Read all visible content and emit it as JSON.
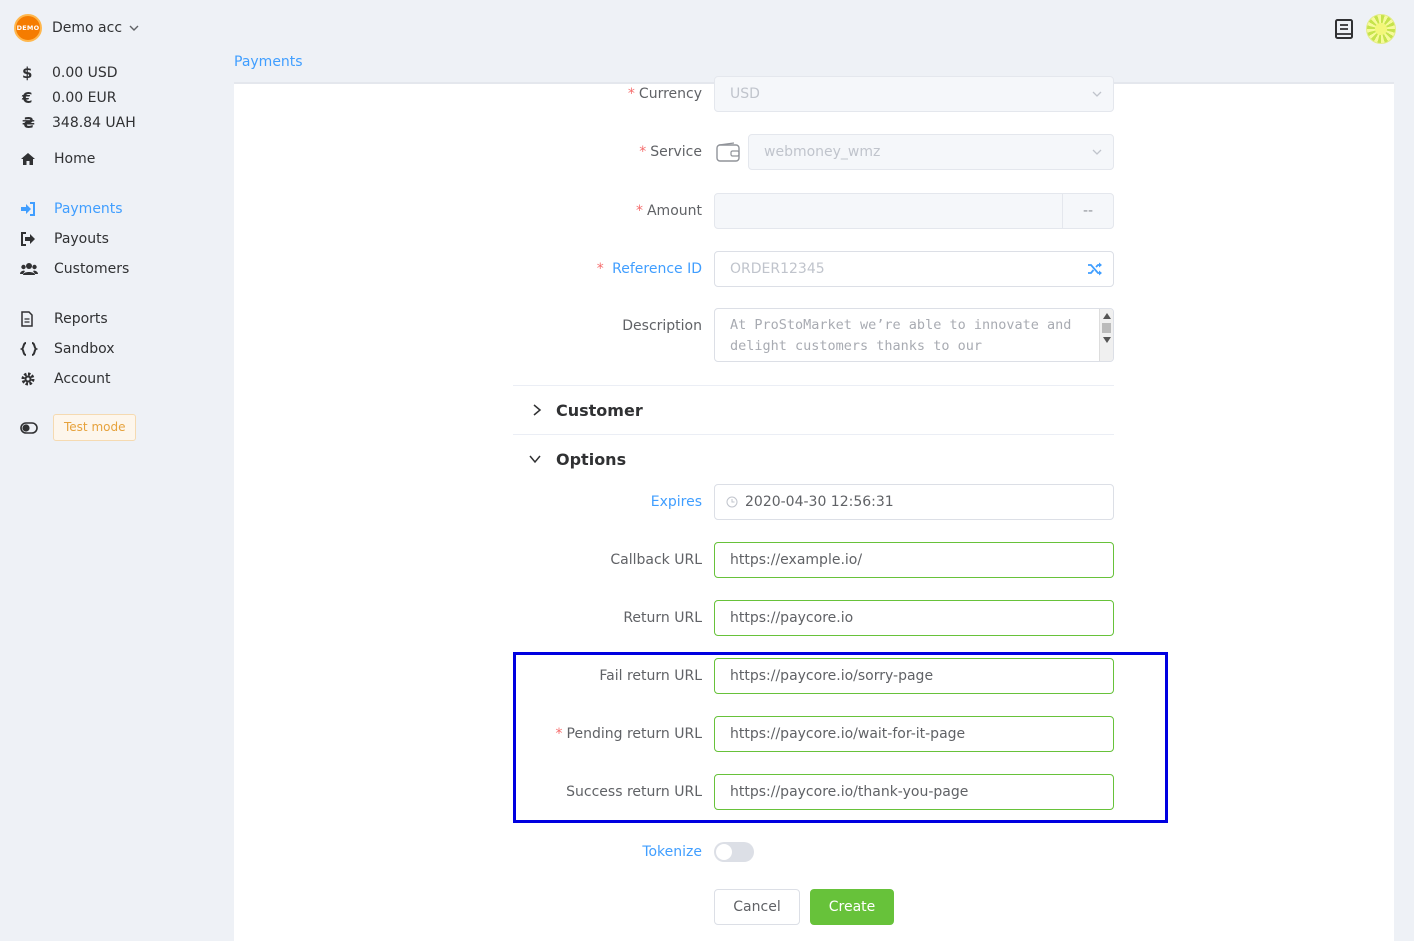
{
  "account": {
    "name": "Demo acc",
    "badge_text": "DEMO"
  },
  "balances": [
    {
      "symbol": "$",
      "amount": "0.00 USD"
    },
    {
      "symbol": "€",
      "amount": "0.00 EUR"
    },
    {
      "symbol": "₴",
      "amount": "348.84 UAH"
    }
  ],
  "nav": {
    "home": "Home",
    "payments": "Payments",
    "payouts": "Payouts",
    "customers": "Customers",
    "reports": "Reports",
    "sandbox": "Sandbox",
    "account": "Account"
  },
  "test_mode": "Test mode",
  "tab": "Payments",
  "form": {
    "currency": {
      "label": "Currency",
      "value": "USD"
    },
    "service": {
      "label": "Service",
      "value": "webmoney_wmz"
    },
    "amount": {
      "label": "Amount",
      "suffix": "--"
    },
    "reference": {
      "label": "Reference ID",
      "placeholder": "ORDER12345"
    },
    "description": {
      "label": "Description",
      "placeholder": "At ProStoMarket we’re able to innovate and delight customers thanks to our"
    },
    "customer_section": "Customer",
    "options_section": "Options",
    "expires": {
      "label": "Expires",
      "value": "2020-04-30 12:56:31"
    },
    "callback": {
      "label": "Callback URL",
      "value": "https://example.io/"
    },
    "return": {
      "label": "Return URL",
      "value": "https://paycore.io"
    },
    "fail_return": {
      "label": "Fail return URL",
      "value": "https://paycore.io/sorry-page"
    },
    "pending_return": {
      "label": "Pending return URL",
      "value": "https://paycore.io/wait-for-it-page"
    },
    "success_return": {
      "label": "Success return URL",
      "value": "https://paycore.io/thank-you-page"
    },
    "tokenize": {
      "label": "Tokenize",
      "enabled": false
    },
    "cancel": "Cancel",
    "create": "Create"
  },
  "colors": {
    "primary": "#409eff",
    "success": "#67c23a",
    "danger": "#f56c6c",
    "warning": "#e6a23c",
    "highlight": "#0000e0"
  }
}
